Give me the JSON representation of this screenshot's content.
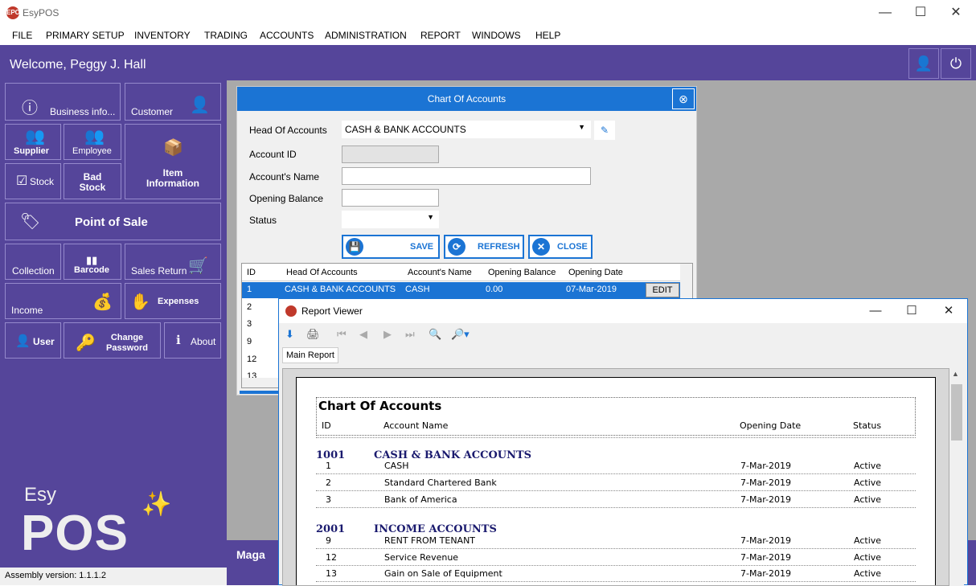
{
  "app": {
    "title": "EsyPOS",
    "logo_text": "EPOS"
  },
  "menu": [
    "FILE",
    "PRIMARY SETUP",
    "INVENTORY",
    "TRADING",
    "ACCOUNTS",
    "ADMINISTRATION",
    "REPORT",
    "WINDOWS",
    "HELP"
  ],
  "welcome": "Welcome, Peggy J. Hall",
  "tiles": {
    "business": "Business info...",
    "customer": "Customer",
    "supplier": "Supplier",
    "employee": "Employee",
    "item_info": "Item\nInformation",
    "stock": "Stock",
    "bad_stock": "Bad\nStock",
    "pos": "Point of Sale",
    "collection": "Collection",
    "barcode": "Barcode",
    "sales_return": "Sales Return",
    "income": "Income",
    "expenses": "Expenses",
    "user": "User",
    "change_password": "Change\nPassword",
    "about": "About"
  },
  "brand": {
    "esy": "Esy",
    "pos": "POS"
  },
  "status_bar": "Assembly version: 1.1.1.2",
  "maga": "Maga",
  "coa": {
    "title": "Chart Of Accounts",
    "labels": {
      "head": "Head Of Accounts",
      "id": "Account ID",
      "name": "Account's Name",
      "opening": "Opening Balance",
      "status": "Status"
    },
    "head_value": "CASH & BANK ACCOUNTS",
    "buttons": {
      "save": "SAVE",
      "refresh": "REFRESH",
      "close": "CLOSE"
    },
    "grid": {
      "headers": [
        "ID",
        "Head Of Accounts",
        "Account's Name",
        "Opening Balance",
        "Opening Date"
      ],
      "selected_row": {
        "id": "1",
        "head": "CASH & BANK ACCOUNTS",
        "name": "CASH",
        "opening": "0.00",
        "date": "07-Mar-2019",
        "action": "EDIT"
      },
      "ids": [
        "2",
        "3",
        "9",
        "12",
        "13"
      ]
    }
  },
  "report_viewer": {
    "title": "Report Viewer",
    "tab": "Main Report",
    "report": {
      "title": "Chart Of Accounts",
      "headers": {
        "id": "ID",
        "name": "Account Name",
        "date": "Opening Date",
        "status": "Status"
      },
      "groups": [
        {
          "code": "1001",
          "name": "CASH & BANK ACCOUNTS",
          "items": [
            {
              "id": "1",
              "name": "CASH",
              "date": "7-Mar-2019",
              "status": "Active"
            },
            {
              "id": "2",
              "name": "Standard Chartered Bank",
              "date": "7-Mar-2019",
              "status": "Active"
            },
            {
              "id": "3",
              "name": "Bank of America",
              "date": "7-Mar-2019",
              "status": "Active"
            }
          ]
        },
        {
          "code": "2001",
          "name": "INCOME ACCOUNTS",
          "items": [
            {
              "id": "9",
              "name": "RENT FROM TENANT",
              "date": "7-Mar-2019",
              "status": "Active"
            },
            {
              "id": "12",
              "name": "Service Revenue",
              "date": "7-Mar-2019",
              "status": "Active"
            },
            {
              "id": "13",
              "name": "Gain on Sale of Equipment",
              "date": "7-Mar-2019",
              "status": "Active"
            }
          ]
        }
      ]
    }
  }
}
